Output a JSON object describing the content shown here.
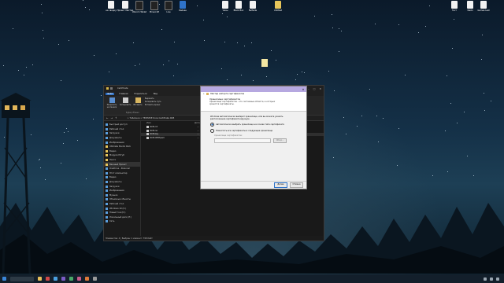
{
  "desktop": {
    "icons": [
      {
        "label": "на сводку",
        "glyph": "file-icon"
      },
      {
        "label": "Проект Мастер",
        "glyph": "file-icon"
      },
      {
        "label": "Wacom Tablet",
        "glyph": "file-icon"
      },
      {
        "label": "Minecraft",
        "glyph": "file-icon"
      },
      {
        "label": "Live",
        "glyph": "file-icon"
      },
      {
        "label": "Кайзен",
        "glyph": "app-icon"
      },
      {
        "label": "Часы",
        "glyph": "file-icon"
      },
      {
        "label": "Black Box",
        "glyph": "file-icon"
      },
      {
        "label": "Selfside",
        "glyph": "file-icon"
      },
      {
        "label": "Untitled",
        "glyph": "file-icon"
      },
      {
        "label": "Тест",
        "glyph": "file-icon"
      },
      {
        "label": "Файл",
        "glyph": "file-icon"
      },
      {
        "label": "Games Last",
        "glyph": "file-icon"
      }
    ]
  },
  "explorer": {
    "title": "Certificate",
    "tabs": [
      "Файл",
      "Главная",
      "Поделиться",
      "Вид"
    ],
    "ribbon": {
      "buttons": [
        "Закрепить на панели",
        "Копировать",
        "Вставить"
      ],
      "lines": [
        "Вырезать",
        "Копировать путь",
        "Вставить ярлык"
      ],
      "group_label": "Буфер обмена"
    },
    "address_path": "> Таблички > ТЕХНИЧЕ Коса Certificate RCB",
    "nav": [
      {
        "label": "Быстрый доступ",
        "icon": "star-icon"
      },
      {
        "label": "Рабочий стол",
        "icon": "desktop-icon"
      },
      {
        "label": "Загрузки",
        "icon": "download-icon"
      },
      {
        "label": "Документы",
        "icon": "document-icon"
      },
      {
        "label": "Изображения",
        "icon": "picture-icon"
      },
      {
        "label": "Ultimate Studio Pack",
        "icon": "folder-icon"
      },
      {
        "label": "Видео",
        "icon": "folder-icon"
      },
      {
        "label": "Модули Ютуб",
        "icon": "folder-icon"
      },
      {
        "label": "Нечто",
        "icon": "folder-icon"
      },
      {
        "label": "Важный Проект",
        "icon": "folder-icon"
      },
      {
        "label": "OneDrive - Personal",
        "icon": "cloud-icon"
      },
      {
        "label": "Этот компьютер",
        "icon": "computer-icon"
      },
      {
        "label": "Видео",
        "icon": "video-icon"
      },
      {
        "label": "Документы",
        "icon": "document-icon"
      },
      {
        "label": "Загрузки",
        "icon": "download-icon"
      },
      {
        "label": "Изображения",
        "icon": "picture-icon"
      },
      {
        "label": "Музыка",
        "icon": "music-icon"
      },
      {
        "label": "Объемные объекты",
        "icon": "cube-icon"
      },
      {
        "label": "Рабочий стол",
        "icon": "desktop-icon"
      },
      {
        "label": "Windows 10 (C:)",
        "icon": "drive-icon"
      },
      {
        "label": "Новый том (D:)",
        "icon": "drive-icon"
      },
      {
        "label": "Локальный диск (E:)",
        "icon": "drive-icon"
      },
      {
        "label": "Сеть",
        "icon": "network-icon"
      }
    ],
    "columns": [
      "Имя",
      "Дата"
    ],
    "files": [
      {
        "name": "RCB.crt",
        "date": "..."
      },
      {
        "name": "RCB.csr",
        "date": "..."
      },
      {
        "name": "RCB.key",
        "date": "..."
      },
      {
        "name": "RCB.CERTpem",
        "date": "..."
      }
    ],
    "status": "Элементов: 4 | Выбран 1 элемент: 798 байт"
  },
  "wizard": {
    "title": "Мастер импорта сертификатов",
    "heading": "Хранилище сертификатов",
    "subheading": "Хранилища сертификатов - это системные области, в которых хранятся сертификаты.",
    "description": "Windows автоматически выберет хранилище, или вы можете указать расположение сертификата вручную.",
    "options": [
      "Автоматически выбрать хранилище на основе типа сертификата",
      "Поместить все сертификаты в следующее хранилище"
    ],
    "store_label": "Хранилище сертификатов:",
    "store_placeholder": "",
    "browse_label": "Обзор...",
    "next_label": "Далее",
    "cancel_label": "Отмена"
  }
}
